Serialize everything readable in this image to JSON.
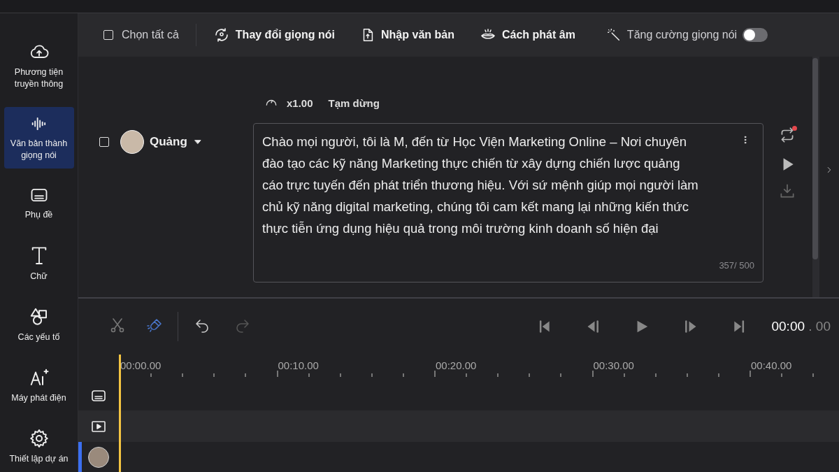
{
  "sidebar": {
    "items": [
      {
        "label": "Phương tiện truyền thông",
        "selected": false
      },
      {
        "label": "Văn bản thành giọng nói",
        "selected": true
      },
      {
        "label": "Phụ đề",
        "selected": false
      },
      {
        "label": "Chữ",
        "selected": false
      },
      {
        "label": "Các yếu tố",
        "selected": false
      },
      {
        "label": "Máy phát điện",
        "selected": false
      },
      {
        "label": "Thiết lập dự án",
        "selected": false
      }
    ]
  },
  "toolbar": {
    "select_all": {
      "label": "Chọn tất cả",
      "checked": false
    },
    "actions": [
      {
        "label": "Thay đổi giọng nói"
      },
      {
        "label": "Nhập văn bản"
      },
      {
        "label": "Cách phát âm"
      }
    ],
    "enhance": {
      "label": "Tăng cường giọng nói",
      "on": false
    }
  },
  "editor": {
    "speed": "x1.00",
    "pause": "Tạm dừng",
    "voice": {
      "name": "Quảng",
      "checked": false
    },
    "text": "Chào mọi người, tôi là M, đến từ Học Viện Marketing Online – Nơi chuyên đào tạo các kỹ năng Marketing thực chiến từ xây dựng chiến lược quảng cáo trực tuyến đến phát triển thương hiệu. Với sứ mệnh giúp mọi người làm chủ kỹ năng digital marketing, chúng tôi cam kết mang lại những kiến thức thực tiễn ứng dụng hiệu quả trong môi trường kinh doanh số hiện đại",
    "counter": "357/ 500"
  },
  "timeline": {
    "time": "00:00",
    "time_fraction": ". 00",
    "ruler": [
      "00:00.00",
      "00:10.00",
      "00:20.00",
      "00:30.00",
      "00:40.00"
    ],
    "tracks": [
      {
        "kind": "subtitle"
      },
      {
        "kind": "video"
      },
      {
        "kind": "voice"
      }
    ]
  }
}
